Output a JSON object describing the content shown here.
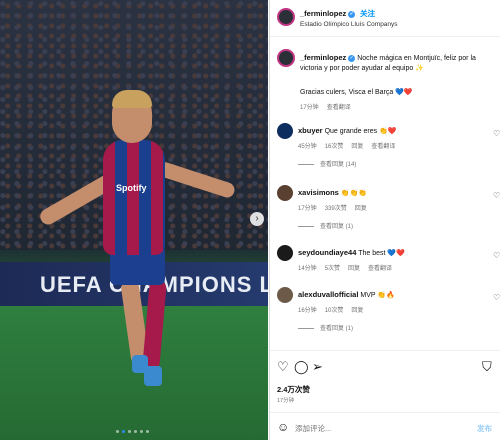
{
  "photo": {
    "board_text": "UEFA CHAMPIONS LEA",
    "sponsor": "Spotify",
    "next_icon": "chevron-right-icon",
    "slide_count": 6,
    "active_slide": 1
  },
  "header": {
    "username": "_ferminlopez",
    "follow_label": "关注",
    "location": "Estadio Olímpico Lluís Companys"
  },
  "caption": {
    "username": "_ferminlopez",
    "text": "Noche mágica en Montjuïc, feliz por la victoria y por poder ayudar al equipo ✨",
    "text2": "Gracias culers, Visca el Barça 💙❤️",
    "time": "17分钟",
    "translate": "查看翻译"
  },
  "comments": [
    {
      "username": "xbuyer",
      "text": "Que grande eres 👏❤️",
      "time": "45分钟",
      "likes": "16次赞",
      "reply": "回复",
      "translate": "查看翻译",
      "replies": "查看回复 (14)",
      "avatar_color": "#0d2d5e"
    },
    {
      "username": "xavisimons",
      "text": "👏👏👏",
      "time": "17分钟",
      "likes": "339次赞",
      "reply": "回复",
      "translate": "",
      "replies": "查看回复 (1)",
      "avatar_color": "#5a4030"
    },
    {
      "username": "seydoundiaye44",
      "text": "The best 💙❤️",
      "time": "14分钟",
      "likes": "5次赞",
      "reply": "回复",
      "translate": "查看翻译",
      "replies": "",
      "avatar_color": "#1a1a1a"
    },
    {
      "username": "alexduvallofficial",
      "text": "MVP 👏🔥",
      "time": "16分钟",
      "likes": "10次赞",
      "reply": "回复",
      "translate": "",
      "replies": "查看回复 (1)",
      "avatar_color": "#6d5a48"
    }
  ],
  "actions": {
    "like_icon": "heart-icon",
    "comment_icon": "comment-icon",
    "share_icon": "send-icon",
    "save_icon": "bookmark-icon"
  },
  "likes": "2.4万次赞",
  "date": "17分钟",
  "add_comment": {
    "placeholder": "添加评论...",
    "post_label": "发布"
  }
}
